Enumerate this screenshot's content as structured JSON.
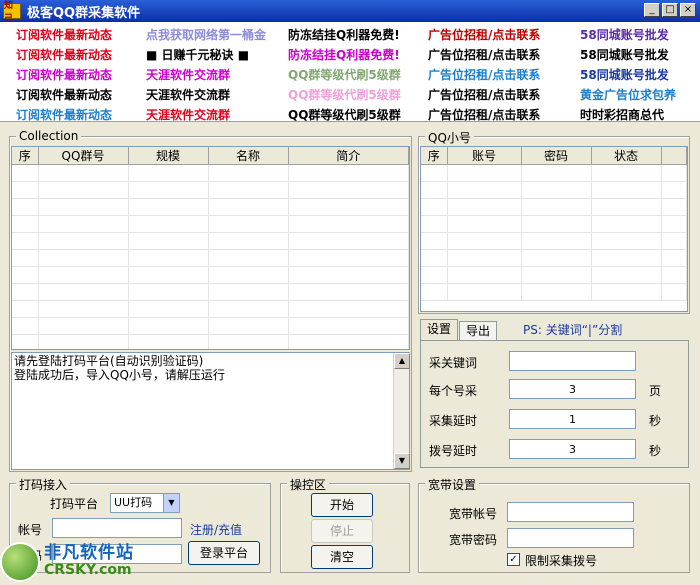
{
  "window": {
    "icon_text": "知己",
    "title": "极客QQ群采集软件",
    "btn_min": "_",
    "btn_max": "□",
    "btn_close": "×"
  },
  "ads": [
    {
      "text": "订阅软件最新动态",
      "color": "#e0001b"
    },
    {
      "text": "点我获取网络第一桶金",
      "color": "#8b8bd8"
    },
    {
      "text": "防冻结挂Q利器免费!",
      "color": "#000000"
    },
    {
      "text": "广告位招租/点击联系",
      "color": "#c00000"
    },
    {
      "text": "58同城账号批发",
      "color": "#5a2aa8"
    },
    {
      "text": "订阅软件最新动态",
      "color": "#e0001b"
    },
    {
      "text": "■ 日赚千元秘诀 ■",
      "color": "#000000"
    },
    {
      "text": "防冻结挂Q利器免费!",
      "color": "#cc00cc"
    },
    {
      "text": "广告位招租/点击联系",
      "color": "#000000"
    },
    {
      "text": "58同城账号批发",
      "color": "#000000"
    },
    {
      "text": "订阅软件最新动态",
      "color": "#cc00cc"
    },
    {
      "text": "天涯软件交流群",
      "color": "#cc00cc"
    },
    {
      "text": "QQ群等级代刷5级群",
      "color": "#80a870"
    },
    {
      "text": "广告位招租/点击联系",
      "color": "#1b7fd0"
    },
    {
      "text": "58同城账号批发",
      "color": "#1b3aa0"
    },
    {
      "text": "订阅软件最新动态",
      "color": "#000000"
    },
    {
      "text": "天涯软件交流群",
      "color": "#000000"
    },
    {
      "text": "QQ群等级代刷5级群",
      "color": "#f0a0d8"
    },
    {
      "text": "广告位招租/点击联系",
      "color": "#000000"
    },
    {
      "text": "黄金广告位求包养",
      "color": "#1b7fd0"
    },
    {
      "text": "订阅软件最新动态",
      "color": "#1b7fd0"
    },
    {
      "text": "天涯软件交流群",
      "color": "#e0001b"
    },
    {
      "text": "QQ群等级代刷5级群",
      "color": "#000000"
    },
    {
      "text": "广告位招租/点击联系",
      "color": "#000000"
    },
    {
      "text": "时时彩招商总代",
      "color": "#000000"
    }
  ],
  "collection": {
    "title": "Collection",
    "columns": [
      "序",
      "QQ群号",
      "规模",
      "名称",
      "简介"
    ]
  },
  "qq_accounts": {
    "title": "QQ小号",
    "columns": [
      "序",
      "账号",
      "密码",
      "状态"
    ]
  },
  "log": {
    "lines": [
      "请先登陆打码平台(自动识别验证码)",
      "登陆成功后，导入QQ小号，请解压运行"
    ]
  },
  "tabs": {
    "items": [
      "设置",
      "导出"
    ],
    "hint": "PS: 关键词“|”分割"
  },
  "settings": {
    "keyword_label": "采关键词",
    "keyword_value": "",
    "per_account_label": "每个号采",
    "per_account_value": "3",
    "per_account_unit": "页",
    "collect_delay_label": "采集延时",
    "collect_delay_value": "1",
    "collect_delay_unit": "秒",
    "dial_delay_label": "拨号延时",
    "dial_delay_value": "3",
    "dial_delay_unit": "秒"
  },
  "captcha": {
    "title": "打码接入",
    "platform_label": "打码平台",
    "platform_value": "UU打码",
    "account_label": "帐号",
    "password_label": "密码",
    "register_link": "注册/充值",
    "login_button": "登录平台"
  },
  "control": {
    "title": "操控区",
    "start": "开始",
    "stop": "停止",
    "clear": "清空"
  },
  "broadband": {
    "title": "宽带设置",
    "account_label": "宽带帐号",
    "password_label": "宽带密码",
    "limit_label": "限制采集拨号",
    "limit_checked": "✓"
  },
  "watermark": {
    "cn": "非凡软件站",
    "en": "CRSKY.com"
  }
}
